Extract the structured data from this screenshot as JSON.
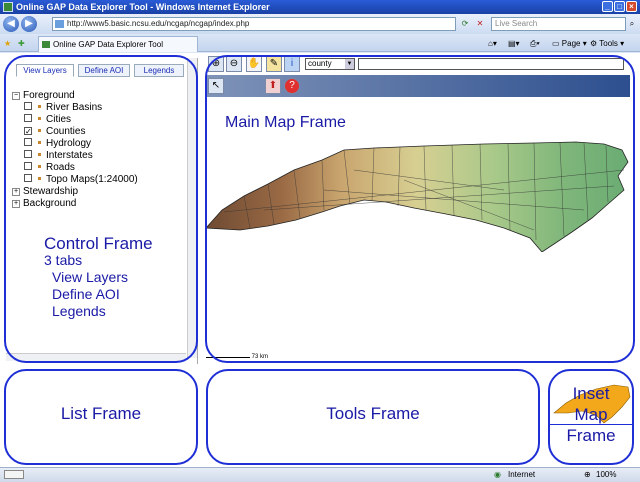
{
  "window": {
    "title": "Online GAP Data Explorer Tool - Windows Internet Explorer"
  },
  "browser": {
    "url": "http://www5.basic.ncsu.edu/ncgap/ncgap/index.php",
    "search_placeholder": "Live Search",
    "tab_title": "Online GAP Data Explorer Tool",
    "commands": {
      "page": "Page",
      "tools": "Tools"
    }
  },
  "control_frame": {
    "tabs": [
      "View Layers",
      "Define AOI",
      "Legends"
    ],
    "tree": {
      "foreground": "Foreground",
      "layers": [
        {
          "label": "River Basins",
          "checked": false
        },
        {
          "label": "Cities",
          "checked": false
        },
        {
          "label": "Counties",
          "checked": true
        },
        {
          "label": "Hydrology",
          "checked": false
        },
        {
          "label": "Interstates",
          "checked": false
        },
        {
          "label": "Roads",
          "checked": false
        },
        {
          "label": "Topo Maps(1:24000)",
          "checked": false
        }
      ],
      "stewardship": "Stewardship",
      "background": "Background"
    },
    "annotation": {
      "title": "Control Frame",
      "line1": "3 tabs",
      "line2": "View Layers",
      "line3": "Define AOI",
      "line4": "Legends"
    }
  },
  "map_frame": {
    "layer_select": "county",
    "title": "Main Map Frame",
    "scale_label": "73 km"
  },
  "bottom": {
    "list_frame": "List Frame",
    "tools_frame": "Tools Frame",
    "inset_line1": "Inset",
    "inset_line2": "Map",
    "inset_line3": "Frame"
  },
  "status": {
    "zone": "Internet",
    "zoom": "100%"
  },
  "colors": {
    "frame_outline": "#1f2fd6",
    "annotation_text": "#1a1aa6"
  }
}
